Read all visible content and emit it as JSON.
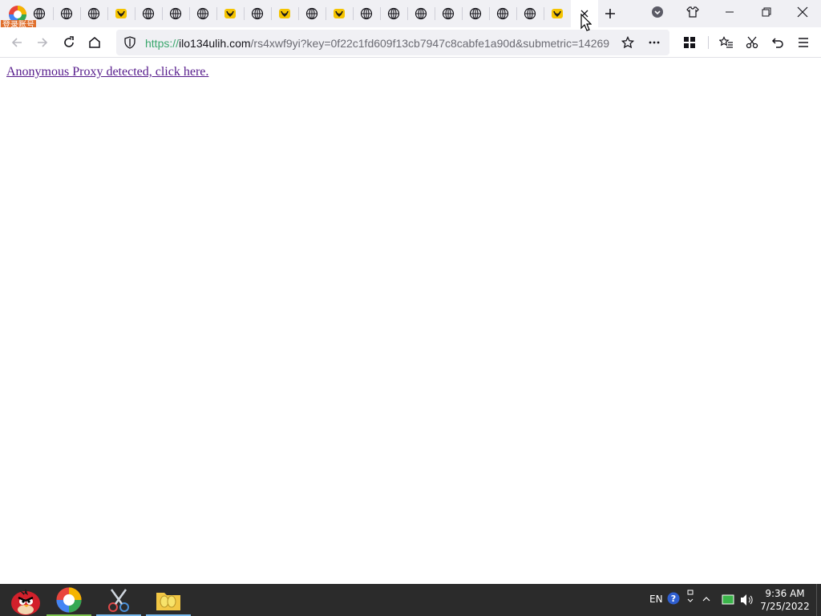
{
  "browser": {
    "login_badge": "登录账号",
    "tabs": [
      {
        "icon": "globe-icon",
        "active": false
      },
      {
        "icon": "globe-icon",
        "active": false
      },
      {
        "icon": "globe-icon",
        "active": false
      },
      {
        "icon": "bag-icon",
        "active": false
      },
      {
        "icon": "globe-icon",
        "active": false
      },
      {
        "icon": "globe-icon",
        "active": false
      },
      {
        "icon": "globe-icon",
        "active": false
      },
      {
        "icon": "bag-icon",
        "active": false
      },
      {
        "icon": "globe-icon",
        "active": false
      },
      {
        "icon": "bag-icon",
        "active": false
      },
      {
        "icon": "globe-icon",
        "active": false
      },
      {
        "icon": "bag-icon",
        "active": false
      },
      {
        "icon": "globe-icon",
        "active": false
      },
      {
        "icon": "globe-icon",
        "active": false
      },
      {
        "icon": "globe-icon",
        "active": false
      },
      {
        "icon": "globe-icon",
        "active": false
      },
      {
        "icon": "globe-icon",
        "active": false
      },
      {
        "icon": "globe-icon",
        "active": false
      },
      {
        "icon": "globe-icon",
        "active": false
      },
      {
        "icon": "bag-icon",
        "active": false
      },
      {
        "icon": "close-icon",
        "active": true
      }
    ],
    "url": {
      "scheme": "https://",
      "host": "ilo134ulih.com",
      "path": "/rs4xwf9yi?key=0f22c1fd609f13cb7947c8cabfe1a90d&submetric=14269"
    },
    "colors": {
      "secure": "#3aa76d",
      "bag_yellow": "#f5c400",
      "link_visited": "#551a8b"
    }
  },
  "page": {
    "link_text": "Anonymous Proxy detected, click here."
  },
  "taskbar": {
    "apps": [
      "angry-birds-icon",
      "browser-icon",
      "scissors-app-icon",
      "folder-icon"
    ],
    "language": "EN",
    "time": "9:36 AM",
    "date": "7/25/2022"
  }
}
